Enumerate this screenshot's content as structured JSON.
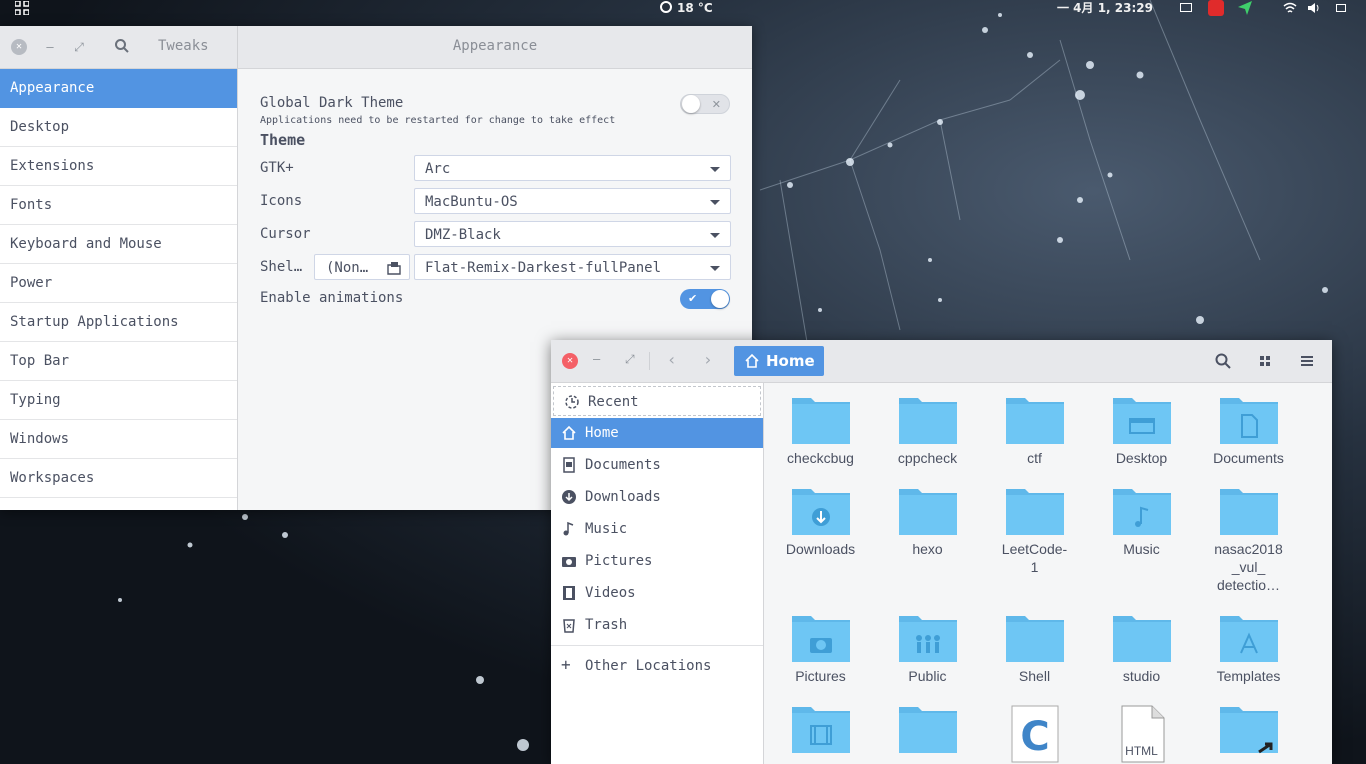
{
  "topbar": {
    "weather": "18 °C",
    "datetime": "一 4月  1, 23:29"
  },
  "tweaks": {
    "title_left": "Tweaks",
    "title_main": "Appearance",
    "sidebar": [
      "Appearance",
      "Desktop",
      "Extensions",
      "Fonts",
      "Keyboard and Mouse",
      "Power",
      "Startup Applications",
      "Top Bar",
      "Typing",
      "Windows",
      "Workspaces"
    ],
    "global_dark_label": "Global Dark Theme",
    "global_dark_note": "Applications need to be restarted for change to take effect",
    "global_dark_on": false,
    "theme_heading": "Theme",
    "gtk_label": "GTK+",
    "gtk_value": "Arc",
    "icons_label": "Icons",
    "icons_value": "MacBuntu-OS",
    "cursor_label": "Cursor",
    "cursor_value": "DMZ-Black",
    "shell_label": "Shel…",
    "shell_file": "(Non…",
    "shell_value": "Flat-Remix-Darkest-fullPanel",
    "animations_label": "Enable animations",
    "animations_on": true
  },
  "files": {
    "path": "Home",
    "sidebar": {
      "recent": "Recent",
      "home": "Home",
      "documents": "Documents",
      "downloads": "Downloads",
      "music": "Music",
      "pictures": "Pictures",
      "videos": "Videos",
      "trash": "Trash",
      "other": "Other Locations"
    },
    "items": [
      {
        "name": "checkcbug",
        "icon": "folder-icon"
      },
      {
        "name": "cppcheck",
        "icon": "folder-icon"
      },
      {
        "name": "ctf",
        "icon": "folder-icon"
      },
      {
        "name": "Desktop",
        "icon": "folder-desktop-icon"
      },
      {
        "name": "Documents",
        "icon": "folder-documents-icon"
      },
      {
        "name": "Downloads",
        "icon": "folder-download-icon"
      },
      {
        "name": "hexo",
        "icon": "folder-icon"
      },
      {
        "name": "LeetCode-\n1",
        "icon": "folder-icon"
      },
      {
        "name": "Music",
        "icon": "folder-music-icon"
      },
      {
        "name": "nasac2018\n_vul_\ndetectio…",
        "icon": "folder-icon"
      },
      {
        "name": "Pictures",
        "icon": "folder-pictures-icon"
      },
      {
        "name": "Public",
        "icon": "folder-public-icon"
      },
      {
        "name": "Shell",
        "icon": "folder-icon"
      },
      {
        "name": "studio",
        "icon": "folder-icon"
      },
      {
        "name": "Templates",
        "icon": "folder-templates-icon"
      },
      {
        "name": "",
        "icon": "folder-videos-icon"
      },
      {
        "name": "",
        "icon": "folder-icon"
      },
      {
        "name": "",
        "icon": "c-source-file-icon"
      },
      {
        "name": "HTML",
        "icon": "html-file-icon"
      },
      {
        "name": "",
        "icon": "folder-link-icon"
      }
    ]
  },
  "colors": {
    "accent": "#5294e2",
    "folder": "#6ec6f4",
    "close": "#f46067"
  }
}
